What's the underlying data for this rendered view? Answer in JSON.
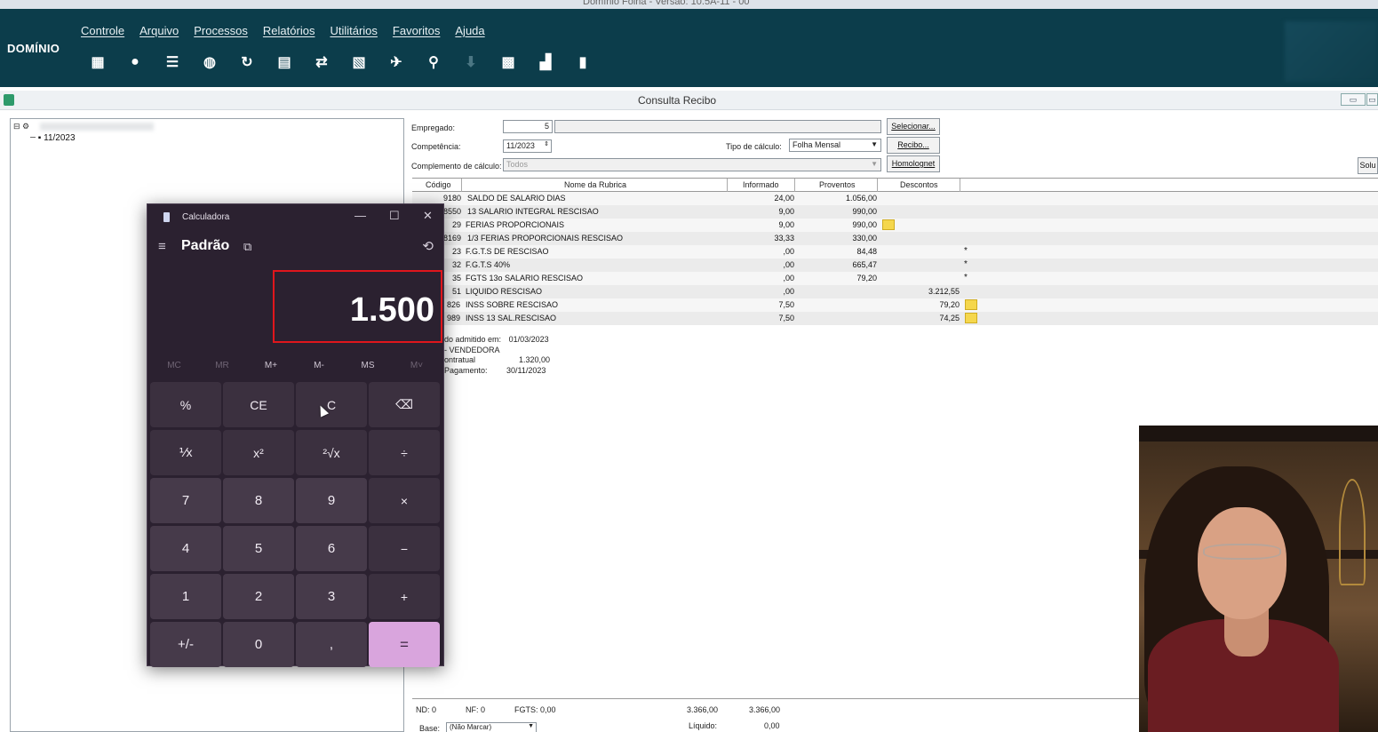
{
  "os": {
    "title": "Domínio Folha - Versão: 10.5A-11 - 00"
  },
  "app": {
    "brand": "DOMÍNIO",
    "menu": [
      "Controle",
      "Arquivo",
      "Processos",
      "Relatórios",
      "Utilitários",
      "Favoritos",
      "Ajuda"
    ],
    "toolbar_icons": [
      "building-icon",
      "user-icon",
      "list-icon",
      "user-search-icon",
      "refresh-icon",
      "table-icon",
      "transfer-icon",
      "document-icon",
      "plane-icon",
      "search-icon",
      "download-icon",
      "calculator-icon",
      "chart-icon",
      "book-icon"
    ]
  },
  "window": {
    "title": "Consulta Recibo"
  },
  "tree": {
    "node": "11/2023"
  },
  "form": {
    "empregado_label": "Empregado:",
    "empregado_value": "5",
    "competencia_label": "Competência:",
    "competencia_value": "11/2023",
    "tipo_calculo_label": "Tipo de cálculo:",
    "tipo_calculo_value": "Folha Mensal",
    "complemento_label": "Complemento de cálculo:",
    "complemento_value": "Todos",
    "btn_selecionar": "Selecionar...",
    "btn_recibo": "Recibo...",
    "btn_homolognet": "Homolognet",
    "btn_solu": "Solu"
  },
  "table": {
    "headers": [
      "Código",
      "Nome da Rubrica",
      "Informado",
      "Proventos",
      "Descontos"
    ],
    "rows": [
      {
        "code": "9180",
        "name": "SALDO DE SALARIO DIAS",
        "informado": "24,00",
        "proventos": "1.056,00",
        "descontos": "",
        "flag": ""
      },
      {
        "code": "8550",
        "name": "13 SALARIO INTEGRAL RESCISAO",
        "informado": "9,00",
        "proventos": "990,00",
        "descontos": "",
        "flag": ""
      },
      {
        "code": "29",
        "name": "FERIAS PROPORCIONAIS",
        "informado": "9,00",
        "proventos": "990,00",
        "descontos": "",
        "flag": "note"
      },
      {
        "code": "8169",
        "name": "1/3 FERIAS PROPORCIONAIS RESCISAO",
        "informado": "33,33",
        "proventos": "330,00",
        "descontos": "",
        "flag": ""
      },
      {
        "code": "23",
        "name": "F.G.T.S DE RESCISAO",
        "informado": ",00",
        "proventos": "84,48",
        "descontos": "",
        "flag": "*"
      },
      {
        "code": "32",
        "name": "F.G.T.S 40%",
        "informado": ",00",
        "proventos": "665,47",
        "descontos": "",
        "flag": "*"
      },
      {
        "code": "35",
        "name": "FGTS 13o SALARIO RESCISAO",
        "informado": ",00",
        "proventos": "79,20",
        "descontos": "",
        "flag": "*"
      },
      {
        "code": "51",
        "name": "LIQUIDO RESCISAO",
        "informado": ",00",
        "proventos": "",
        "descontos": "3.212,55",
        "flag": ""
      },
      {
        "code": "826",
        "name": "INSS SOBRE RESCISAO",
        "informado": "7,50",
        "proventos": "",
        "descontos": "79,20",
        "flag": "note"
      },
      {
        "code": "989",
        "name": "INSS 13 SAL.RESCISAO",
        "informado": "7,50",
        "proventos": "",
        "descontos": "74,25",
        "flag": "note"
      }
    ]
  },
  "info": {
    "admitido_label": "do admitido em:",
    "admitido_value": "01/03/2023",
    "cargo": "- VENDEDORA",
    "contratual_label": "ontratual",
    "contratual_value": "1.320,00",
    "pagamento_label": "Pagamento:",
    "pagamento_value": "30/11/2023"
  },
  "footer": {
    "nd": "ND:  0",
    "nf": "NF:  0",
    "fgts": "FGTS:  0,00",
    "total_proventos": "3.366,00",
    "total_descontos": "3.366,00",
    "base_label": "Base:",
    "base_value": "(Não Marcar)",
    "liquido_label": "Líquido:",
    "liquido_value": "0,00"
  },
  "calculator": {
    "title": "Calculadora",
    "mode": "Padrão",
    "display": "1.500",
    "memory": [
      "MC",
      "MR",
      "M+",
      "M-",
      "MS",
      "M˅"
    ],
    "keys": [
      "%",
      "CE",
      "C",
      "⌫",
      "⅟x",
      "x²",
      "²√x",
      "÷",
      "7",
      "8",
      "9",
      "×",
      "4",
      "5",
      "6",
      "−",
      "1",
      "2",
      "3",
      "+",
      "+/-",
      "0",
      ",",
      "="
    ]
  }
}
